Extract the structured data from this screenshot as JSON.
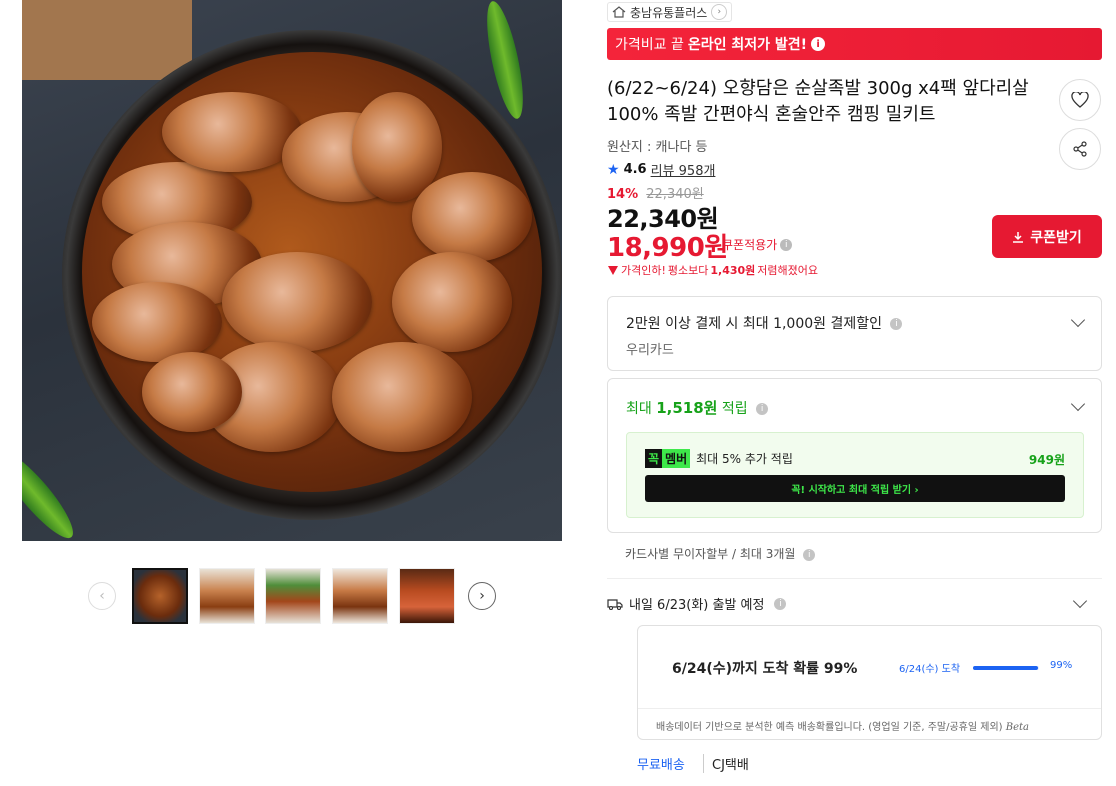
{
  "gallery": {
    "main_image_alt": "족발 이미지",
    "thumbnails": [
      "thumb-1",
      "thumb-2",
      "thumb-3",
      "thumb-4",
      "thumb-5"
    ],
    "active_index": 0
  },
  "seller": {
    "name": "충남유통플러스"
  },
  "promo": {
    "prefix": "가격비교 끝",
    "highlight": "온라인 최저가 발견!"
  },
  "product": {
    "title": "(6/22~6/24) 오향담은 순살족발 300g x4팩 앞다리살100% 족발 간편야식 혼술안주 캠핑 밀키트",
    "origin": "원산지 : 캐나다 등",
    "rating": "4.6",
    "reviews": "리뷰 958개"
  },
  "price": {
    "discount_pct": "14%",
    "original": "22,340원",
    "main": "22,340원",
    "coupon_price": "18,990원",
    "coupon_label": "쿠폰적용가",
    "drop_prefix": "가격인하!",
    "drop_middle": "평소보다",
    "drop_amount": "1,430원",
    "drop_suffix": "저렴해졌어요",
    "coupon_button": "쿠폰받기"
  },
  "card_offer": {
    "line1": "2만원 이상 결제 시 최대 1,000원 결제할인",
    "line2": "우리카드"
  },
  "points": {
    "prefix": "최대",
    "amount": "1,518원",
    "suffix": "적립",
    "member_badge_1": "꼭",
    "member_badge_2": "멤버",
    "member_text": "최대 5% 추가 적립",
    "member_amount": "949원",
    "cta": "꼭! 시작하고 최대 적립 받기  ›"
  },
  "installment": "카드사별 무이자할부 / 최대 3개월",
  "shipping": {
    "title": "내일 6/23(화) 출발 예정",
    "arrival": "6/24(수)까지 도착 확률 99%",
    "bar_label": "6/24(수) 도착",
    "bar_pct": "99%",
    "bar_value": 0.99,
    "note": "배송데이터 기반으로 분석한 예측 배송확률입니다. (영업일 기준, 주말/공휴일 제외)",
    "beta": "Beta",
    "free": "무료배송",
    "courier": "CJ택배"
  },
  "colors": {
    "accent": "#e61932",
    "link_blue": "#1c63f2",
    "green": "#17a21a"
  }
}
